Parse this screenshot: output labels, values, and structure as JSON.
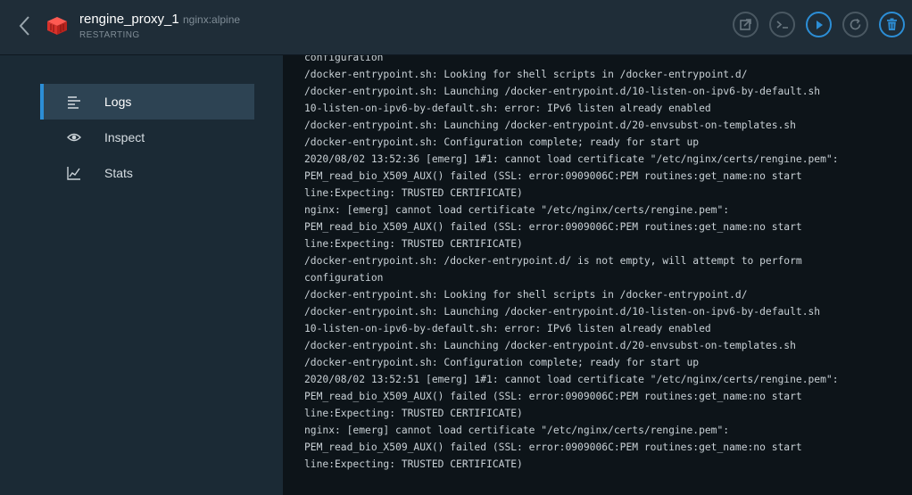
{
  "header": {
    "title": "rengine_proxy_1",
    "image": "nginx:alpine",
    "status": "RESTARTING",
    "icons": {
      "back": "chevron-left-icon",
      "container": "container-cube-icon"
    },
    "actions": [
      {
        "name": "open-external-button",
        "icon": "external-link-icon"
      },
      {
        "name": "exec-terminal-button",
        "icon": "terminal-icon"
      },
      {
        "name": "start-button",
        "icon": "play-icon"
      },
      {
        "name": "restart-button",
        "icon": "restart-icon"
      },
      {
        "name": "delete-button",
        "icon": "trash-icon"
      }
    ]
  },
  "sidebar": {
    "items": [
      {
        "label": "Logs",
        "icon": "logs-icon",
        "active": true
      },
      {
        "label": "Inspect",
        "icon": "eye-icon",
        "active": false
      },
      {
        "label": "Stats",
        "icon": "chart-icon",
        "active": false
      }
    ]
  },
  "logs": {
    "lines": [
      "configuration",
      "/docker-entrypoint.sh: Looking for shell scripts in /docker-entrypoint.d/",
      "/docker-entrypoint.sh: Launching /docker-entrypoint.d/10-listen-on-ipv6-by-default.sh",
      "10-listen-on-ipv6-by-default.sh: error: IPv6 listen already enabled",
      "/docker-entrypoint.sh: Launching /docker-entrypoint.d/20-envsubst-on-templates.sh",
      "/docker-entrypoint.sh: Configuration complete; ready for start up",
      "2020/08/02 13:52:36 [emerg] 1#1: cannot load certificate \"/etc/nginx/certs/rengine.pem\":",
      "PEM_read_bio_X509_AUX() failed (SSL: error:0909006C:PEM routines:get_name:no start",
      "line:Expecting: TRUSTED CERTIFICATE)",
      "nginx: [emerg] cannot load certificate \"/etc/nginx/certs/rengine.pem\":",
      "PEM_read_bio_X509_AUX() failed (SSL: error:0909006C:PEM routines:get_name:no start",
      "line:Expecting: TRUSTED CERTIFICATE)",
      "/docker-entrypoint.sh: /docker-entrypoint.d/ is not empty, will attempt to perform",
      "configuration",
      "/docker-entrypoint.sh: Looking for shell scripts in /docker-entrypoint.d/",
      "/docker-entrypoint.sh: Launching /docker-entrypoint.d/10-listen-on-ipv6-by-default.sh",
      "10-listen-on-ipv6-by-default.sh: error: IPv6 listen already enabled",
      "/docker-entrypoint.sh: Launching /docker-entrypoint.d/20-envsubst-on-templates.sh",
      "/docker-entrypoint.sh: Configuration complete; ready for start up",
      "2020/08/02 13:52:51 [emerg] 1#1: cannot load certificate \"/etc/nginx/certs/rengine.pem\":",
      "PEM_read_bio_X509_AUX() failed (SSL: error:0909006C:PEM routines:get_name:no start",
      "line:Expecting: TRUSTED CERTIFICATE)",
      "nginx: [emerg] cannot load certificate \"/etc/nginx/certs/rengine.pem\":",
      "PEM_read_bio_X509_AUX() failed (SSL: error:0909006C:PEM routines:get_name:no start",
      "line:Expecting: TRUSTED CERTIFICATE)"
    ]
  },
  "colors": {
    "accent": "#2c8ed6",
    "container_icon": "#e3342f",
    "header_bg": "#1f2d38",
    "sidebar_bg": "#1b2a35",
    "logs_bg": "#0d1419"
  }
}
